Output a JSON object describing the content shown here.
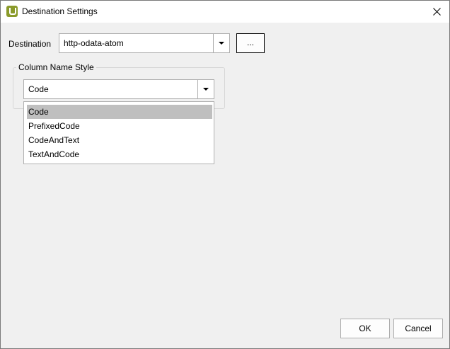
{
  "window": {
    "title": "Destination Settings",
    "app_icon": "app-logo-u",
    "close_icon": "close-icon"
  },
  "destination": {
    "label": "Destination",
    "value": "http-odata-atom",
    "browse_label": "..."
  },
  "column_name_style": {
    "group_label": "Column Name Style",
    "selected": "Code",
    "options": [
      "Code",
      "PrefixedCode",
      "CodeAndText",
      "TextAndCode"
    ],
    "highlighted_index": 0
  },
  "buttons": {
    "ok": "OK",
    "cancel": "Cancel"
  },
  "colors": {
    "window_bg": "#f0f0f0",
    "titlebar_bg": "#ffffff",
    "highlight": "#bfbfbf",
    "app_icon": "#8a9a2a"
  }
}
